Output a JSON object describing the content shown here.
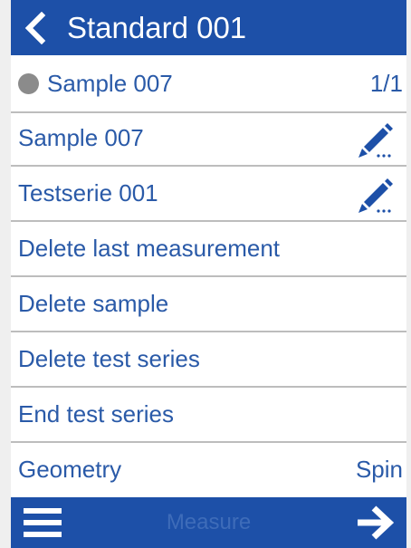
{
  "header": {
    "title": "Standard 001",
    "back_icon": "chevron-left-icon"
  },
  "status": {
    "indicator_color": "#8b8b8b",
    "label": "Sample 007",
    "count": "1/1"
  },
  "rows": [
    {
      "label": "Sample 007",
      "icon": "pencil-icon"
    },
    {
      "label": "Testserie 001",
      "icon": "pencil-icon"
    },
    {
      "label": "Delete last measurement"
    },
    {
      "label": "Delete sample"
    },
    {
      "label": "Delete test series"
    },
    {
      "label": "End test series"
    },
    {
      "label": "Geometry",
      "value": "Spin"
    }
  ],
  "footer": {
    "menu_icon": "menu-icon",
    "measure_label": "Measure",
    "forward_icon": "arrow-right-icon"
  },
  "colors": {
    "accent": "#1d50a8",
    "text": "#2a5aa8",
    "divider": "#bdbdbd",
    "disabled": "#3e6cb9"
  }
}
